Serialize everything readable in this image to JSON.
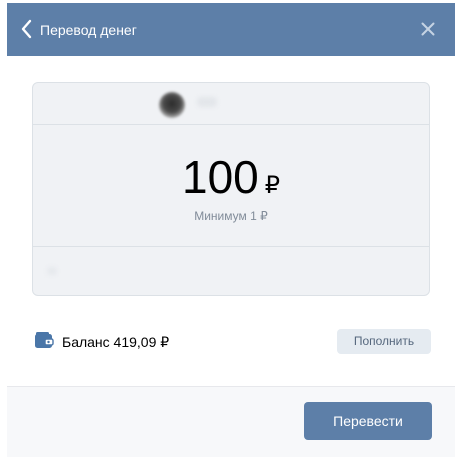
{
  "header": {
    "title": "Перевод денег",
    "back_icon": "chevron-left-icon",
    "close_icon": "close-icon",
    "background_color": "#5d7fa8"
  },
  "transfer": {
    "amount": "100",
    "currency": "₽",
    "minimum_label": "Минимум 1 ₽"
  },
  "balance": {
    "icon": "wallet-icon",
    "label": "Баланс 419,09 ₽",
    "topup_label": "Пополнить"
  },
  "footer": {
    "submit_label": "Перевести",
    "accent_color": "#5d7fa8"
  }
}
